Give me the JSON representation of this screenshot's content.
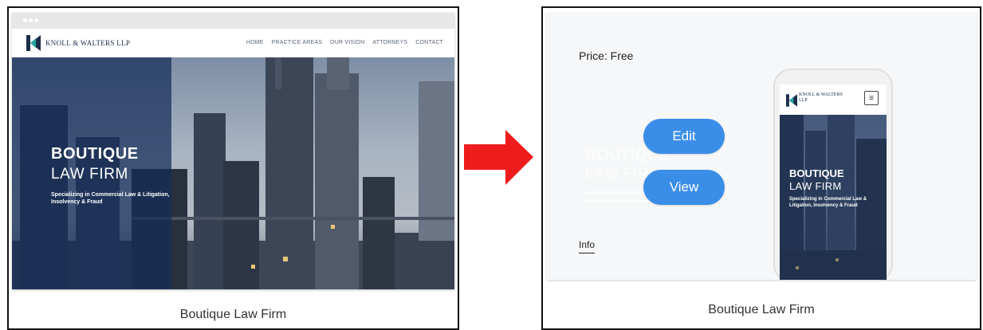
{
  "left_panel": {
    "site": {
      "logo_text": "KNOLL & WALTERS LLP",
      "nav": [
        "HOME",
        "PRACTICE AREAS",
        "OUR VISION",
        "ATTORNEYS",
        "CONTACT"
      ],
      "hero_title_line1": "BOUTIQUE",
      "hero_title_line2": "LAW FIRM",
      "hero_subtitle": "Specializing in Commercial Law & Litigation, Insolvency & Fraud"
    },
    "caption": "Boutique Law Firm"
  },
  "right_panel": {
    "price_label": "Price: Free",
    "edit_button": "Edit",
    "view_button": "View",
    "info_link": "Info",
    "ghost_title_line1": "BOUTIQUE",
    "ghost_title_line2": "LAW FIRM",
    "phone": {
      "logo_text": "KNOLL & WALTERS LLP",
      "menu_icon": "hamburger-menu-icon",
      "hero_title_line1": "BOUTIQUE",
      "hero_title_line2": "LAW FIRM",
      "hero_subtitle": "Specializing in Commercial Law & Litigation, Insolvency & Fraud"
    },
    "caption": "Boutique Law Firm"
  },
  "colors": {
    "accent_blue": "#3a8ee8",
    "arrow_red": "#ee1c1c",
    "navy": "#1c2d4a"
  },
  "icons": {
    "logo": "knoll-walters-logo-icon",
    "arrow": "right-arrow-icon"
  }
}
